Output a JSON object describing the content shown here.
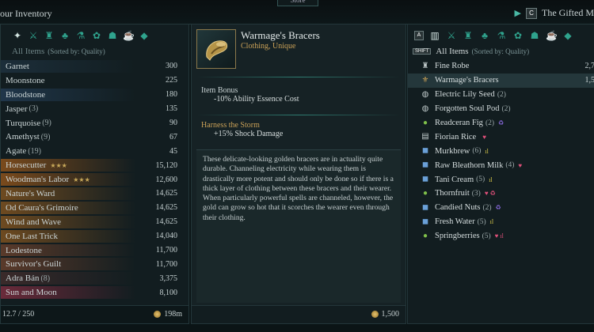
{
  "topbar": {
    "title": "our Inventory",
    "store_label": "Store",
    "key_hint": "C",
    "merchant": "The Gifted M"
  },
  "left": {
    "sub_label": "All Items",
    "sort_label": "(Sorted by: Quality)",
    "items": [
      {
        "name": "Garnet",
        "count": "",
        "stars": "",
        "value": "300",
        "color": ""
      },
      {
        "name": "Moonstone",
        "count": "",
        "stars": "",
        "value": "225",
        "color": ""
      },
      {
        "name": "Bloodstone",
        "count": "",
        "stars": "",
        "value": "180",
        "color": ""
      },
      {
        "name": "Jasper",
        "count": "(3)",
        "stars": "",
        "value": "135",
        "color": ""
      },
      {
        "name": "Turquoise",
        "count": "(9)",
        "stars": "",
        "value": "90",
        "color": ""
      },
      {
        "name": "Amethyst",
        "count": "(9)",
        "stars": "",
        "value": "67",
        "color": ""
      },
      {
        "name": "Agate",
        "count": "(19)",
        "stars": "",
        "value": "45",
        "color": ""
      },
      {
        "name": "Horsecutter",
        "count": "",
        "stars": "★★★",
        "value": "15,120",
        "color": "#7a4a1c"
      },
      {
        "name": "Woodman's Labor",
        "count": "",
        "stars": "★★★",
        "value": "12,600",
        "color": "#7a4a1c"
      },
      {
        "name": "Nature's Ward",
        "count": "",
        "stars": "",
        "value": "14,625",
        "color": "#6e4a20"
      },
      {
        "name": "Od Caura's Grimoire",
        "count": "",
        "stars": "",
        "value": "14,625",
        "color": "#6e4a20"
      },
      {
        "name": "Wind and Wave",
        "count": "",
        "stars": "",
        "value": "14,625",
        "color": "#6e4a20"
      },
      {
        "name": "One Last Trick",
        "count": "",
        "stars": "",
        "value": "14,040",
        "color": "#6e4a20"
      },
      {
        "name": "Lodestone",
        "count": "",
        "stars": "",
        "value": "11,700",
        "color": "#5a3a2a"
      },
      {
        "name": "Survivor's Guilt",
        "count": "",
        "stars": "",
        "value": "11,700",
        "color": "#5a3a2a"
      },
      {
        "name": "Adra Bán",
        "count": "(8)",
        "stars": "",
        "value": "3,375",
        "color": "#3a2a2a"
      },
      {
        "name": "Sun and Moon",
        "count": "",
        "stars": "",
        "value": "8,100",
        "color": "#6a2a3a"
      }
    ],
    "weight": "12.7 / 250",
    "money": "198m"
  },
  "item": {
    "name": "Warmage's Bracers",
    "type": "Clothing, Unique",
    "bonus_head": "Item Bonus",
    "bonus_line": "-10% Ability Essence Cost",
    "harness_head": "Harness the Storm",
    "harness_line": "+15% Shock Damage",
    "description": "These delicate-looking golden bracers are in actuality quite durable. Channeling electricity while wearing them is drastically more potent and should only be done so if there is a thick layer of clothing between these bracers and their wearer. When particularly powerful spells are channeled, however, the gold can grow so hot that it scorches the wearer even through their clothing.",
    "price": "1,500"
  },
  "right": {
    "sub_label": "All Items",
    "sort_label": "(Sorted by: Quality)",
    "items": [
      {
        "name": "Fine Robe",
        "count": "",
        "tag": "",
        "value": "2,7",
        "icon": "♜"
      },
      {
        "name": "Warmage's Bracers",
        "count": "",
        "tag": "",
        "value": "1,5",
        "icon": "⚜"
      },
      {
        "name": "Electric Lily Seed",
        "count": "(2)",
        "tag": "",
        "value": "",
        "icon": "◍"
      },
      {
        "name": "Forgotten Soul Pod",
        "count": "(2)",
        "tag": "",
        "value": "",
        "icon": "◍"
      },
      {
        "name": "Readceran Fig",
        "count": "(2)",
        "tag": "♻",
        "value": "",
        "icon": "●"
      },
      {
        "name": "Fiorian Rice",
        "count": "",
        "tag": "♥",
        "value": "",
        "icon": "▤"
      },
      {
        "name": "Murkbrew",
        "count": "(6)",
        "tag": "ıl",
        "value": "",
        "icon": "◼"
      },
      {
        "name": "Raw Bleathorn Milk",
        "count": "(4)",
        "tag": "♥",
        "value": "",
        "icon": "◼"
      },
      {
        "name": "Tani Cream",
        "count": "(5)",
        "tag": "ıl",
        "value": "",
        "icon": "◼"
      },
      {
        "name": "Thornfruit",
        "count": "(3)",
        "tag": "♥ ♻",
        "value": "",
        "icon": "●"
      },
      {
        "name": "Candied Nuts",
        "count": "(2)",
        "tag": "♻",
        "value": "",
        "icon": "◼"
      },
      {
        "name": "Fresh Water",
        "count": "(5)",
        "tag": "ıl",
        "value": "",
        "icon": "◼"
      },
      {
        "name": "Springberries",
        "count": "(5)",
        "tag": "♥ ıl",
        "value": "",
        "icon": "●"
      }
    ]
  },
  "colors": {
    "accent": "#2fa38d",
    "gold": "#caa157"
  }
}
